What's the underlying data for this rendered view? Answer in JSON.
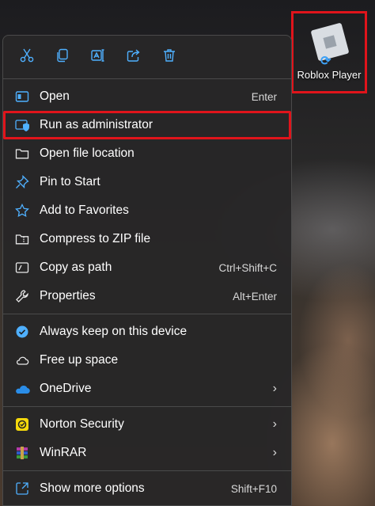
{
  "desktop": {
    "icon_label": "Roblox Player"
  },
  "toolbar": {
    "icons": [
      "cut-icon",
      "copy-icon",
      "rename-icon",
      "share-icon",
      "delete-icon"
    ]
  },
  "menu": {
    "open": {
      "label": "Open",
      "shortcut": "Enter"
    },
    "run_admin": {
      "label": "Run as administrator"
    },
    "open_location": {
      "label": "Open file location"
    },
    "pin_start": {
      "label": "Pin to Start"
    },
    "favorites": {
      "label": "Add to Favorites"
    },
    "zip": {
      "label": "Compress to ZIP file"
    },
    "copy_path": {
      "label": "Copy as path",
      "shortcut": "Ctrl+Shift+C"
    },
    "properties": {
      "label": "Properties",
      "shortcut": "Alt+Enter"
    },
    "keep_device": {
      "label": "Always keep on this device"
    },
    "free_space": {
      "label": "Free up space"
    },
    "onedrive": {
      "label": "OneDrive"
    },
    "norton": {
      "label": "Norton Security"
    },
    "winrar": {
      "label": "WinRAR"
    },
    "more_options": {
      "label": "Show more options",
      "shortcut": "Shift+F10"
    }
  },
  "colors": {
    "highlight": "#e0141b",
    "accent_blue": "#3da0f5",
    "menu_bg": "#282728"
  }
}
